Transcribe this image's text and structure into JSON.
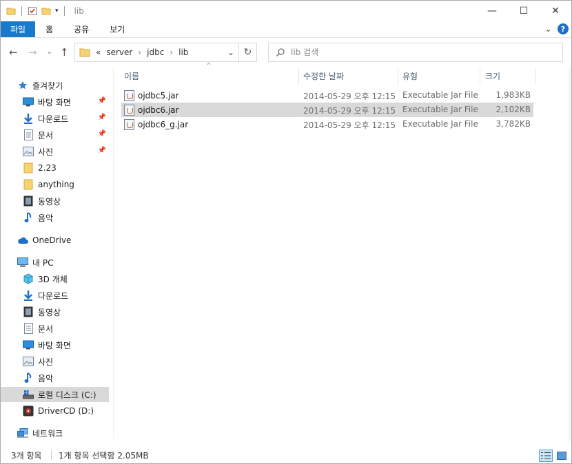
{
  "window": {
    "title": "lib",
    "minimize": "—",
    "maximize": "☐",
    "close": "✕"
  },
  "ribbon": {
    "tabs": [
      {
        "label": "파일"
      },
      {
        "label": "홈"
      },
      {
        "label": "공유"
      },
      {
        "label": "보기"
      }
    ],
    "expand": "⌄",
    "help": "?"
  },
  "address": {
    "prefix": "«",
    "crumbs": [
      "server",
      "jdbc",
      "lib"
    ],
    "sep": "›",
    "dropdown": "⌄",
    "refresh": "↻"
  },
  "search": {
    "placeholder": "lib 검색"
  },
  "nav": {
    "quick_access": "즐겨찾기",
    "quick_items": [
      "바탕 화면",
      "다운로드",
      "문서",
      "사진",
      "2.23",
      "anything",
      "동영상",
      "음악"
    ],
    "onedrive": "OneDrive",
    "this_pc": "내 PC",
    "pc_items": [
      "3D 개체",
      "다운로드",
      "동영상",
      "문서",
      "바탕 화면",
      "사진",
      "음악",
      "로컬 디스크 (C:)",
      "DriverCD (D:)"
    ],
    "network": "네트워크"
  },
  "columns": {
    "name": "이름",
    "date": "수정한 날짜",
    "type": "유형",
    "size": "크기"
  },
  "files": [
    {
      "name": "ojdbc5.jar",
      "date": "2014-05-29 오후 12:15",
      "type": "Executable Jar File",
      "size": "1,983KB"
    },
    {
      "name": "ojdbc6.jar",
      "date": "2014-05-29 오후 12:15",
      "type": "Executable Jar File",
      "size": "2,102KB"
    },
    {
      "name": "ojdbc6_g.jar",
      "date": "2014-05-29 오후 12:15",
      "type": "Executable Jar File",
      "size": "3,782KB"
    }
  ],
  "status": {
    "count": "3개 항목",
    "selection": "1개 항목 선택함 2.05MB"
  },
  "colors": {
    "accent": "#1979ca",
    "selection": "#d9d9d9",
    "header_text": "#4c607a"
  }
}
